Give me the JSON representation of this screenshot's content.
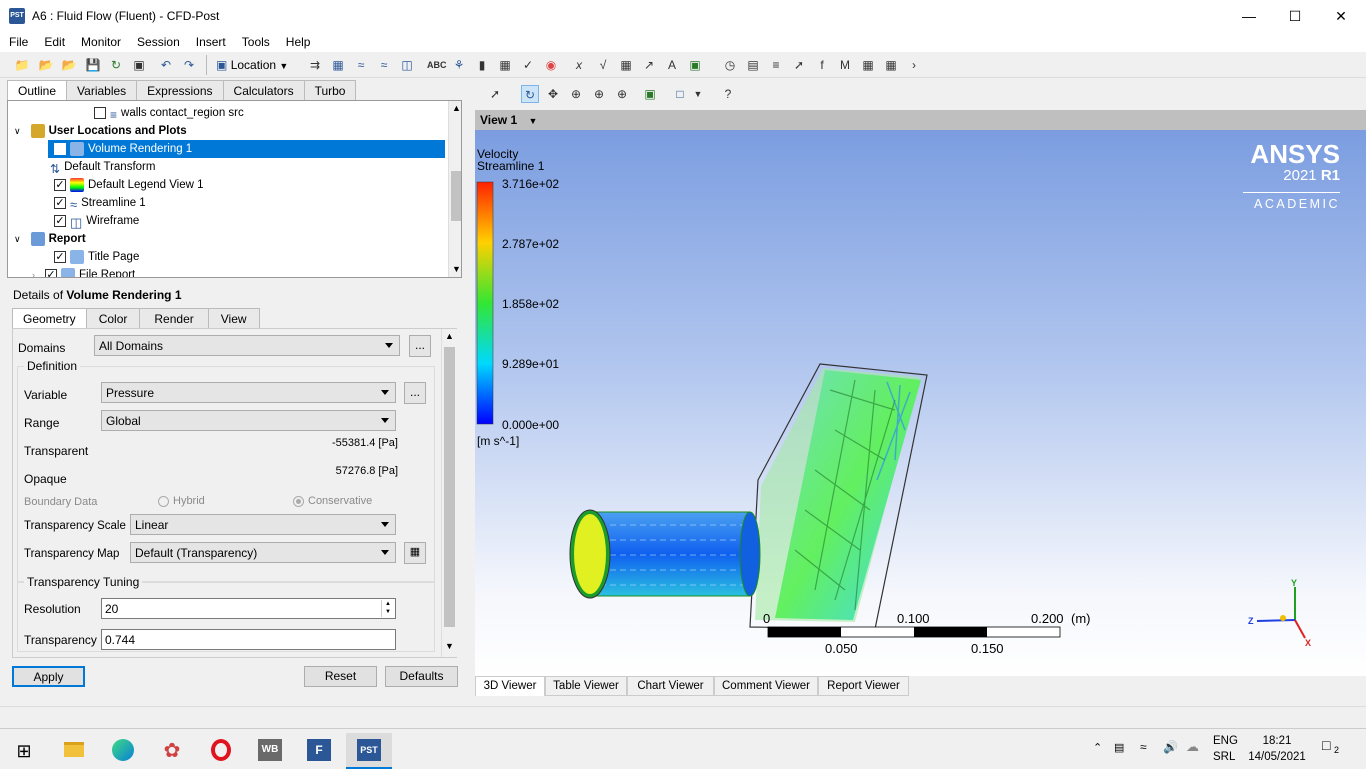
{
  "window": {
    "title": "A6 : Fluid Flow (Fluent) - CFD-Post",
    "app_icon": "PST"
  },
  "menu": [
    "File",
    "Edit",
    "Monitor",
    "Session",
    "Insert",
    "Tools",
    "Help"
  ],
  "toolbar": {
    "location_label": "Location"
  },
  "left": {
    "tabs": [
      "Outline",
      "Variables",
      "Expressions",
      "Calculators",
      "Turbo"
    ],
    "tree": {
      "row0": "walls contact_region src",
      "row1": "User Locations and Plots",
      "row2": "Volume Rendering 1",
      "row3": "Default Transform",
      "row4": "Default Legend View 1",
      "row5": "Streamline 1",
      "row6": "Wireframe",
      "row7": "Report",
      "row8": "Title Page",
      "row9": "File Report"
    },
    "details": {
      "prefix": "Details of ",
      "object": "Volume Rendering 1",
      "tabs": [
        "Geometry",
        "Color",
        "Render",
        "View"
      ],
      "domains_label": "Domains",
      "domains_value": "All Domains",
      "definition_label": "Definition",
      "variable_label": "Variable",
      "variable_value": "Pressure",
      "range_label": "Range",
      "range_value": "Global",
      "transparent_label": "Transparent",
      "transparent_value": "-55381.4 [Pa]",
      "opaque_label": "Opaque",
      "opaque_value": "57276.8 [Pa]",
      "boundary_label": "Boundary Data",
      "hybrid_label": "Hybrid",
      "conservative_label": "Conservative",
      "tscale_label": "Transparency Scale",
      "tscale_value": "Linear",
      "tmap_label": "Transparency Map",
      "tmap_value": "Default (Transparency)",
      "tuning_label": "Transparency Tuning",
      "resolution_label": "Resolution",
      "resolution_value": "20",
      "transparency_label": "Transparency",
      "transparency_value": "0.744",
      "ellipsis": "..."
    },
    "buttons": {
      "apply": "Apply",
      "reset": "Reset",
      "defaults": "Defaults"
    }
  },
  "viewer": {
    "view_label": "View 1",
    "legend": {
      "title1": "Velocity",
      "title2": "Streamline 1",
      "ticks": [
        "3.716e+02",
        "2.787e+02",
        "1.858e+02",
        "9.289e+01",
        "0.000e+00"
      ],
      "unit": "[m s^-1]"
    },
    "brand": {
      "name": "ANSYS",
      "version": "2021",
      "release": "R1",
      "edition": "ACADEMIC"
    },
    "scale": {
      "top": [
        "0",
        "0.100",
        "0.200",
        "(m)"
      ],
      "bottom": [
        "0.050",
        "0.150"
      ]
    },
    "axes": {
      "x": "X",
      "y": "Y",
      "z": "Z"
    },
    "bottom_tabs": [
      "3D Viewer",
      "Table Viewer",
      "Chart Viewer",
      "Comment Viewer",
      "Report Viewer"
    ]
  },
  "taskbar": {
    "apps": [
      "WB",
      "F",
      "PST"
    ],
    "lang1": "ENG",
    "lang2": "SRL",
    "time": "18:21",
    "date": "14/05/2021",
    "notif_count": "2"
  },
  "colors": {
    "selection": "#0078d7",
    "ansys_bg_top": "#7b9de0",
    "ansys_bg_bottom": "#ffffff"
  }
}
